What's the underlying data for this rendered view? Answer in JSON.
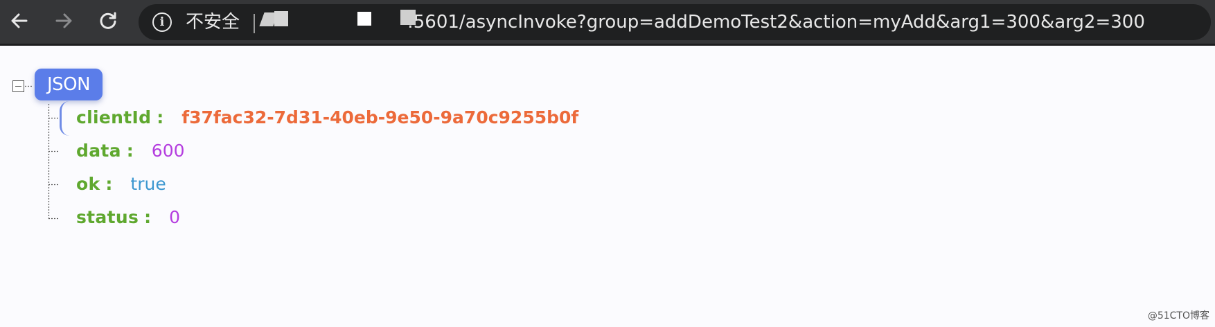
{
  "toolbar": {
    "back_icon": "arrow-left-icon",
    "forward_icon": "arrow-right-icon",
    "reload_icon": "reload-icon",
    "security_icon": "info-icon",
    "security_icon_glyph": "i",
    "security_label": "不安全",
    "url_visible": ":5601/asyncInvoke?group=addDemoTest2&action=myAdd&arg1=300&arg2=300"
  },
  "json_viewer": {
    "root_label": "JSON",
    "toggle_icon": "collapse-minus-icon",
    "entries": [
      {
        "key": "clientId",
        "colon": ":",
        "value": "f37fac32-7d31-40eb-9e50-9a70c9255b0f",
        "type": "string"
      },
      {
        "key": "data",
        "colon": ":",
        "value": "600",
        "type": "number"
      },
      {
        "key": "ok",
        "colon": ":",
        "value": "true",
        "type": "boolean"
      },
      {
        "key": "status",
        "colon": ":",
        "value": "0",
        "type": "number"
      }
    ]
  },
  "colors": {
    "key": "#5fa82f",
    "string": "#ec6a3a",
    "number": "#b43ddf",
    "boolean": "#3c97d0",
    "badge": "#5b7de9",
    "toolbar": "#353638"
  },
  "watermark": "@51CTO博客"
}
